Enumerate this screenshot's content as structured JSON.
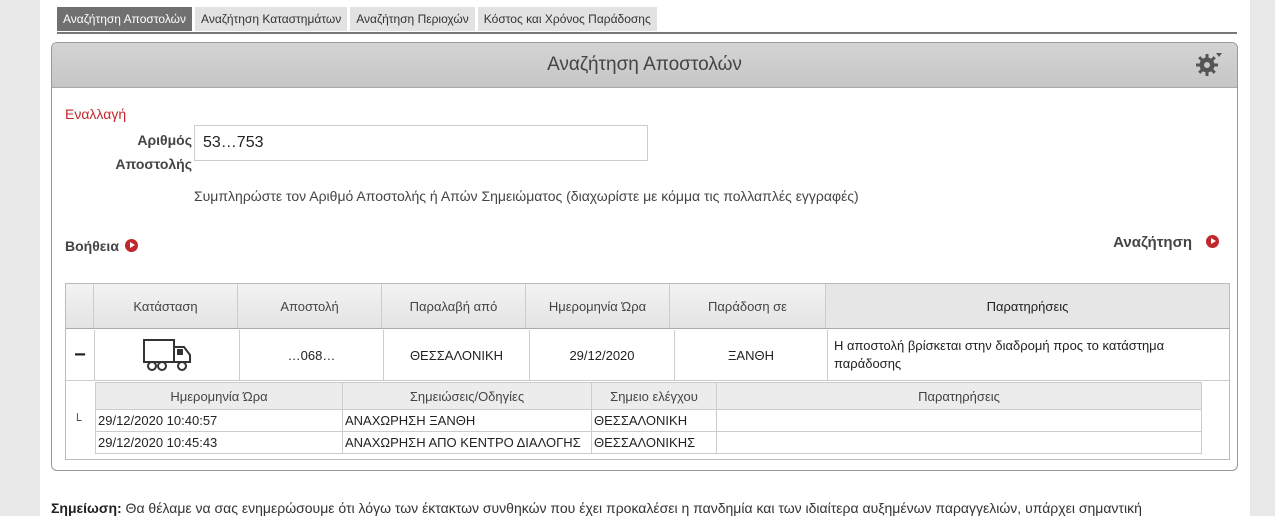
{
  "tabs": [
    {
      "label": "Αναζήτηση Αποστολών",
      "active": true
    },
    {
      "label": "Αναζήτηση Καταστημάτων",
      "active": false
    },
    {
      "label": "Αναζήτηση Περιοχών",
      "active": false
    },
    {
      "label": "Κόστος και Χρόνος Παράδοσης",
      "active": false
    }
  ],
  "panel": {
    "title": "Αναζήτηση Αποστολών",
    "settings_icon": "gear-icon",
    "toggle_link": "Εναλλαγή",
    "field_label_line1": "Αριθμός",
    "field_label_line2": "Αποστολής",
    "shipment_value": "53…753",
    "hint": "Συμπληρώστε τον Αριθμό Αποστολής ή Απών Σημειώματος (διαχωρίστε με κόμμα τις πολλαπλές εγγραφές)",
    "help_label": "Βοήθεια",
    "search_label": "Αναζήτηση"
  },
  "results": {
    "headers": [
      "Κατάσταση",
      "Αποστολή",
      "Παραλαβή από",
      "Ημερομηνία Ώρα",
      "Παράδοση σε",
      "Παρατηρήσεις"
    ],
    "row": {
      "status_icon": "truck-icon",
      "shipment": "…068…",
      "pickup_from": "ΘΕΣΣΑΛΟΝΙΚΗ",
      "date": "29/12/2020",
      "deliver_to": "ΞΑΝΘΗ",
      "remarks": "Η αποστολή βρίσκεται στην διαδρομή προς το κατάστημα παράδοσης"
    },
    "history_headers": [
      "Ημερομηνία Ώρα",
      "Σημειώσεις/Οδηγίες",
      "Σημειο ελέγχου",
      "Παρατηρήσεις"
    ],
    "history": [
      {
        "datetime": "29/12/2020 10:40:57",
        "note": "ΑΝΑΧΩΡΗΣΗ ΞΑΝΘΗ",
        "checkpoint": "ΘΕΣΣΑΛΟΝΙΚΗ",
        "remarks": ""
      },
      {
        "datetime": "29/12/2020 10:45:43",
        "note": "ΑΝΑΧΩΡΗΣΗ ΑΠΟ ΚΕΝΤΡΟ ΔΙΑΛΟΓΗΣ",
        "checkpoint": "ΘΕΣΣΑΛΟΝΙΚΗΣ",
        "remarks": ""
      }
    ]
  },
  "note": {
    "label": "Σημείωση:",
    "text": " Θα θέλαμε να σας ενημερώσουμε ότι λόγω των έκτακτων συνθηκών που έχει προκαλέσει η πανδημία και των ιδιαίτερα αυξημένων παραγγελιών, υπάρχει σημαντική"
  },
  "colors": {
    "accent": "#c0282d",
    "tab_active": "#707070",
    "header_bg": "#c9c9c9"
  }
}
